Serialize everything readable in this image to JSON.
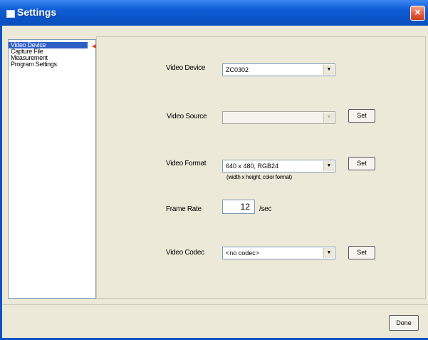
{
  "window": {
    "title": "Settings",
    "close_label": "×"
  },
  "sidebar": {
    "items": [
      {
        "label": "Video Device"
      },
      {
        "label": "Capture File"
      },
      {
        "label": "Measurement"
      },
      {
        "label": "Program Settings"
      }
    ]
  },
  "video_device": {
    "device_label": "Video Device",
    "device_value": "ZC0302",
    "source_label": "Video Source",
    "source_value": "",
    "format_label": "Video Format",
    "format_value": "640  x  480, RGB24",
    "format_hint": "(width x height, color format)",
    "frame_rate_label": "Frame Rate",
    "frame_rate_value": "12",
    "frame_rate_unit": "/sec",
    "codec_label": "Video Codec",
    "codec_value": "<no codec>",
    "set_label": "Set"
  },
  "footer": {
    "done_label": "Done"
  },
  "colors": {
    "titlebar": "#0b54c7",
    "selection": "#2f5fc6",
    "arrow": "#e2401c",
    "panel": "#ece9d8"
  }
}
